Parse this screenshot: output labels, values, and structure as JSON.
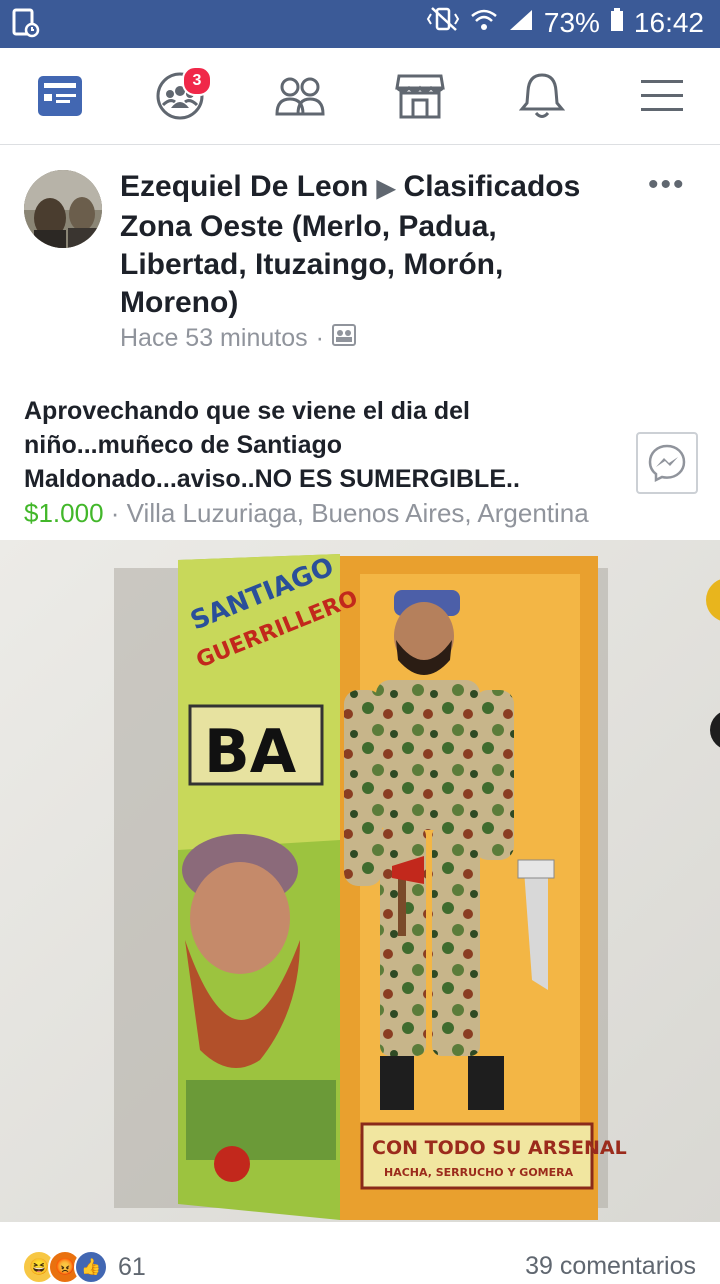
{
  "status_bar": {
    "battery": "73%",
    "time": "16:42"
  },
  "nav": {
    "items": [
      {
        "name": "news-feed",
        "icon": "news-feed-icon"
      },
      {
        "name": "friend-requests",
        "icon": "friends-group-icon",
        "badge": "3"
      },
      {
        "name": "groups",
        "icon": "people-icon"
      },
      {
        "name": "marketplace",
        "icon": "marketplace-icon"
      },
      {
        "name": "notifications",
        "icon": "bell-icon"
      },
      {
        "name": "menu",
        "icon": "hamburger-icon"
      }
    ],
    "active_color": "#4267b2"
  },
  "post": {
    "author": "Ezequiel De Leon",
    "arrow": "▶",
    "group": "Clasificados Zona Oeste (Merlo, Padua, Libertad, Ituzaingo, Morón, Moreno)",
    "time": "Hace 53 minutos",
    "separator": "·",
    "title": "Aprovechando que se viene el dia del niño...muñeco de Santiago Maldonado...aviso..NO ES SUMERGIBLE..",
    "price": "$1.000",
    "location_sep": "·",
    "location": "Villa Luzuriaga, Buenos Aires, Argentina",
    "more": "•••"
  },
  "photo": {
    "box_title_1": "SANTIAGO",
    "box_title_2": "GUERRILLERO",
    "logo": "BA",
    "banner_1": "CON TODO SU ARSENAL",
    "banner_2": "HACHA, SERRUCHO Y GOMERA"
  },
  "footer": {
    "reaction_count": "61",
    "comments": "39 comentarios"
  }
}
